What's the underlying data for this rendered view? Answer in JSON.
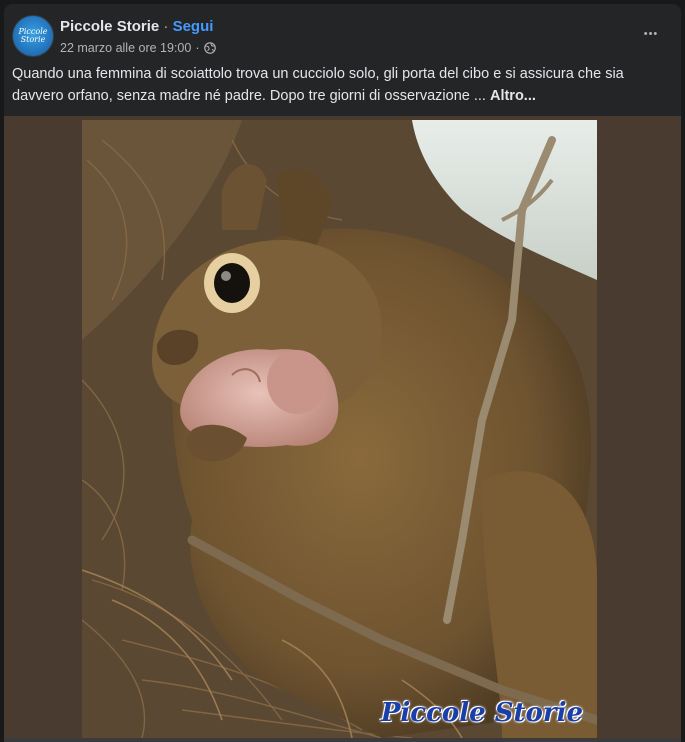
{
  "post": {
    "page_name": "Piccole Storie",
    "separator": " · ",
    "follow_label": "Segui",
    "timestamp": "22 marzo alle ore 19:00",
    "meta_separator": "·",
    "privacy_icon": "globe-icon",
    "more_options_icon": "more-options-icon",
    "more_options_label": "•••",
    "avatar_text": "Piccole Storie",
    "caption": "Quando una femmina di scoiattolo trova un cucciolo solo, gli porta del cibo e si assicura che sia davvero orfano, senza madre né padre. Dopo tre giorni di osservazione ... ",
    "caption_more": "Altro...",
    "image_watermark": "Piccole Storie"
  },
  "colors": {
    "background": "#18191a",
    "card": "#242526",
    "text_primary": "#e4e6eb",
    "text_secondary": "#b0b3b8",
    "link_blue": "#4599ff"
  }
}
